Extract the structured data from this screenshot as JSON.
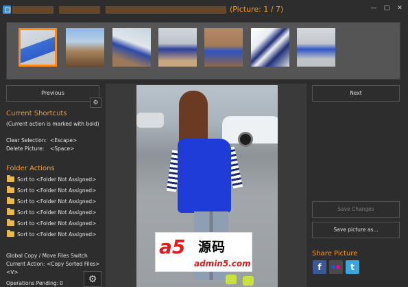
{
  "title_bar": {
    "counter": "(Picture: 1 / 7)",
    "minimize_glyph": "—",
    "maximize_glyph": "□",
    "close_glyph": "✕"
  },
  "thumbnails": {
    "selected_index": 0,
    "count": 7
  },
  "nav": {
    "previous_label": "Previous",
    "next_label": "Next"
  },
  "shortcuts": {
    "title": "Current Shortcuts",
    "note": "(Current action is marked with bold)",
    "clear_label": "Clear Selection:",
    "clear_key": "<Escape>",
    "delete_label": "Delete Picture:",
    "delete_key": "<Space>"
  },
  "folder_actions": {
    "title": "Folder Actions",
    "items": [
      "Sort to <Folder Not Assigned>",
      "Sort to <Folder Not Assigned>",
      "Sort to <Folder Not Assigned>",
      "Sort to <Folder Not Assigned>",
      "Sort to <Folder Not Assigned>",
      "Sort to <Folder Not Assigned>"
    ]
  },
  "status": {
    "global_switch": "Global Copy / Move Files Switch",
    "current_action": "Current Action: <Copy Sorted Files>",
    "switch_key": "<V>",
    "pending": "Operations Pending:",
    "pending_count": "0"
  },
  "right_panel": {
    "save_changes": "Save Changes",
    "save_as": "Save picture as...",
    "share_title": "Share Picture",
    "facebook_glyph": "f",
    "twitter_glyph": "t"
  },
  "watermark": {
    "mark": "a5",
    "cn_text": "源码",
    "site": "admin5.com"
  },
  "colors": {
    "accent": "#ff9a1f",
    "background": "#2d2d2d",
    "selection_border": "#ff8a1a"
  },
  "icons": [
    "app-icon",
    "settings-icon",
    "gear-icon",
    "folder-icon",
    "facebook-icon",
    "flickr-icon",
    "twitter-icon"
  ]
}
